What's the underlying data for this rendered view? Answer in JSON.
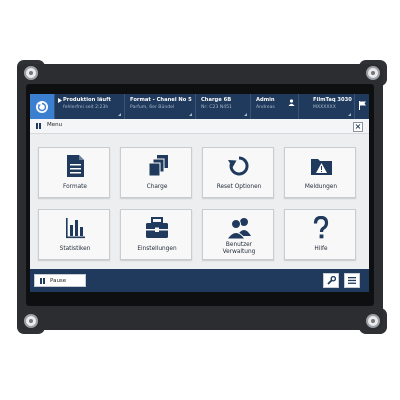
{
  "header": {
    "segments": [
      {
        "title": "Produktion läuft",
        "subtitle": "fehlerfrei seit 2:23h"
      },
      {
        "title": "Format - Chanel No 5",
        "subtitle": "Parfum, 6er Bündel"
      },
      {
        "title": "Charge 6B",
        "subtitle": "Nr: C23 N451"
      },
      {
        "title": "Admin",
        "subtitle": "Andreas"
      },
      {
        "title": "FilmTaq 3030",
        "subtitle": "MXXXXXX"
      }
    ]
  },
  "menu": {
    "label": "Menu",
    "close_icon": "close-icon"
  },
  "tiles": [
    {
      "label": "Formate",
      "icon": "document-icon"
    },
    {
      "label": "Charge",
      "icon": "stack-icon"
    },
    {
      "label": "Reset Optionen",
      "icon": "reset-icon"
    },
    {
      "label": "Meldungen",
      "icon": "warning-folder-icon"
    },
    {
      "label": "Statistiken",
      "icon": "bar-chart-icon"
    },
    {
      "label": "Einstellungen",
      "icon": "toolbox-icon"
    },
    {
      "label_line1": "Benutzer",
      "label_line2": "Verwaltung",
      "icon": "users-icon"
    },
    {
      "label": "Hilfe",
      "icon": "question-icon"
    }
  ],
  "footer": {
    "pause_label": "Pause",
    "wrench_icon": "wrench-icon",
    "hamburger_icon": "hamburger-icon"
  },
  "colors": {
    "header_bg": "#1f3a5c",
    "accent": "#3b7fd0",
    "tile_bg": "#f8f8f9"
  }
}
